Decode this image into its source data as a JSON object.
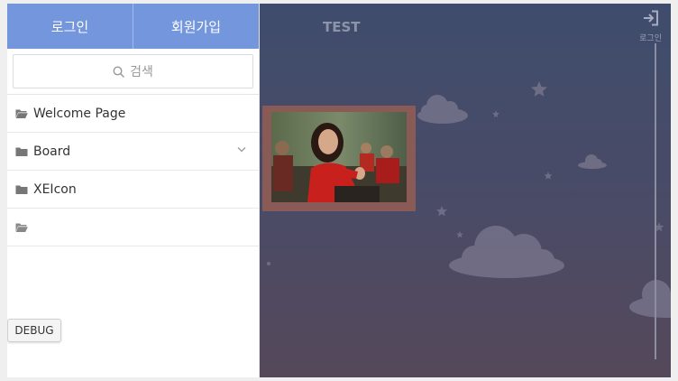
{
  "sidebar": {
    "auth": {
      "login_label": "로그인",
      "signup_label": "회원가입"
    },
    "search": {
      "label": "검색",
      "icon": "search-icon"
    },
    "menu": [
      {
        "label": "Welcome Page",
        "icon": "folder-open-icon"
      },
      {
        "label": "Board",
        "icon": "folder-icon",
        "has_submenu": true
      },
      {
        "label": "XEIcon",
        "icon": "folder-icon"
      },
      {
        "label": "",
        "icon": "folder-open-icon"
      }
    ],
    "debug_label": "DEBUG"
  },
  "header": {
    "brand": "TEST",
    "login_icon_label": "로그인",
    "login_icon": "sign-in-icon"
  },
  "colors": {
    "auth_bar": "#7396dc",
    "main_top": "#3f4c6d",
    "main_bottom": "#55485a",
    "photo_frame": "#8a5a57"
  }
}
